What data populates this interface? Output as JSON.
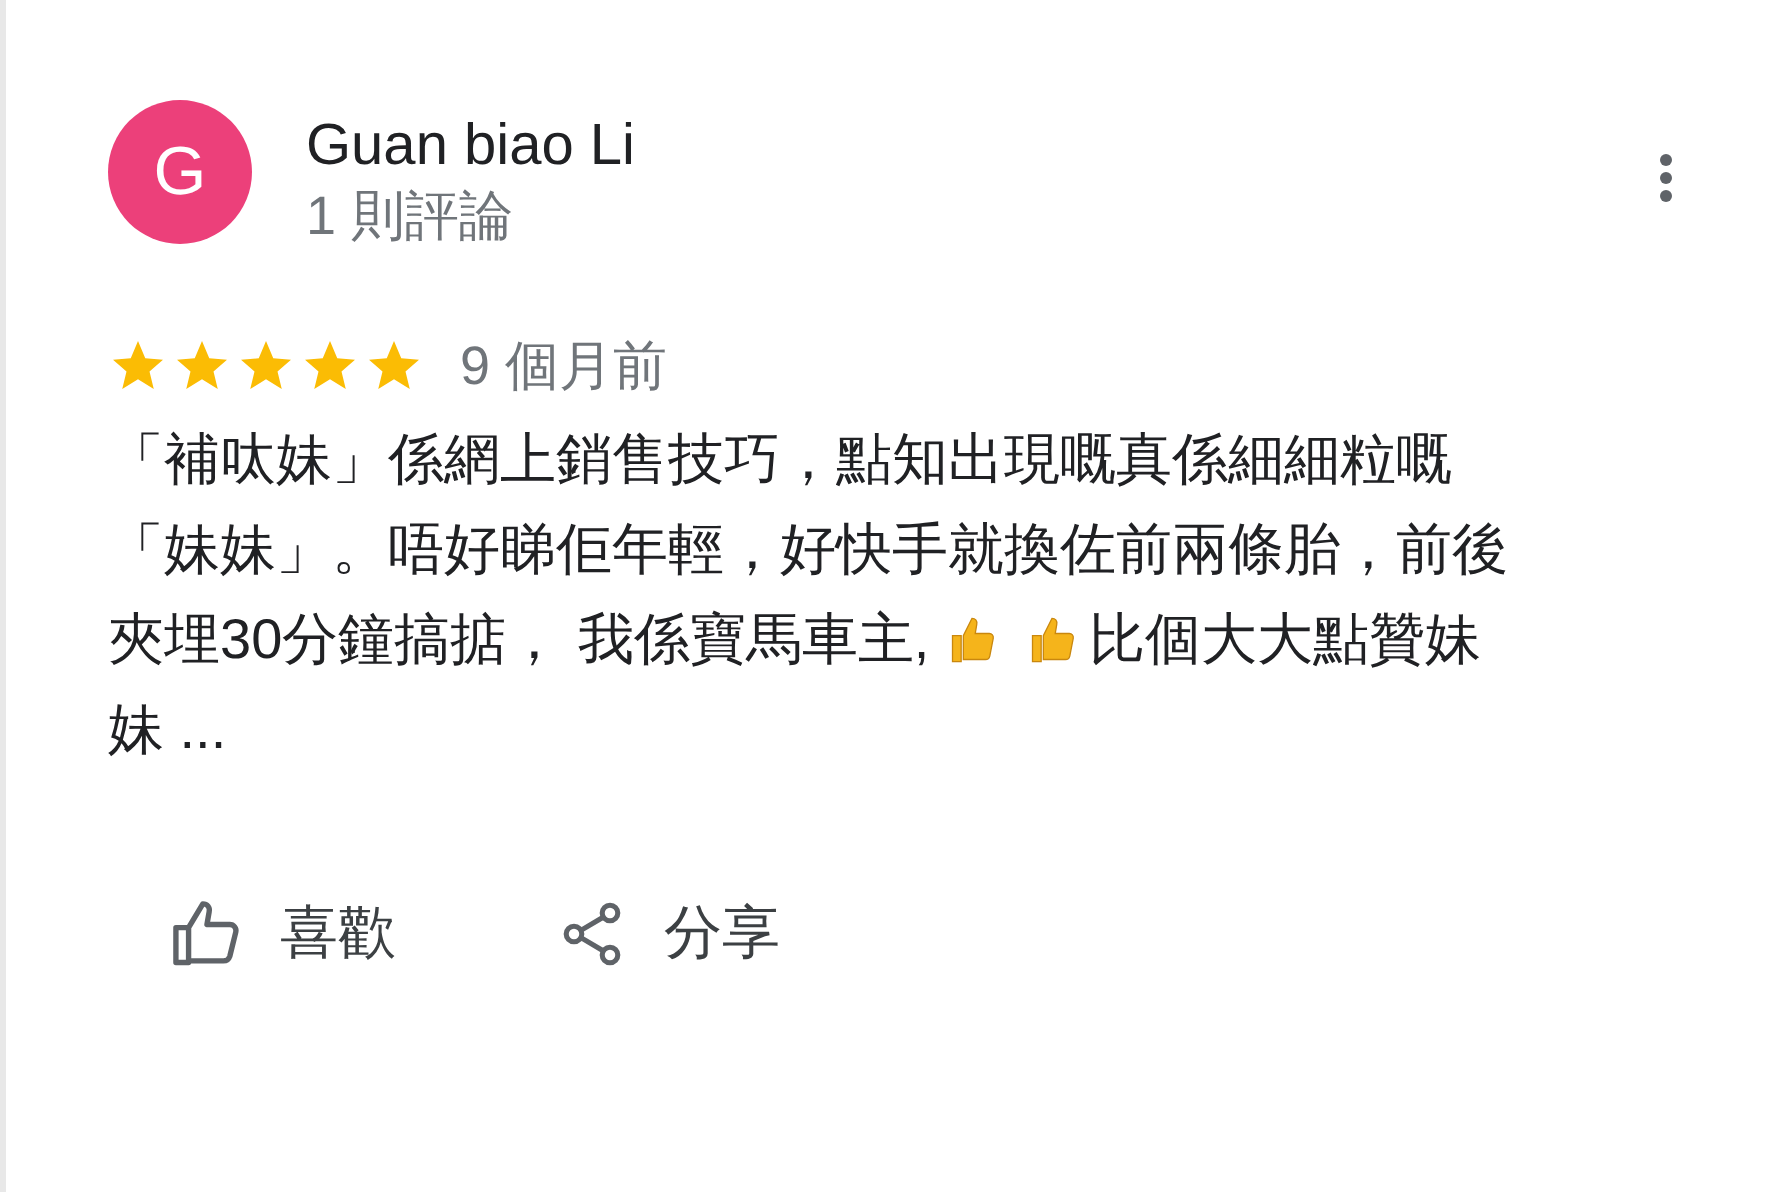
{
  "review": {
    "avatar_letter": "G",
    "author": "Guan biao Li",
    "review_count": "1 則評論",
    "stars": 5,
    "date": "9 個月前",
    "text_lines": [
      [
        {
          "kind": "text",
          "text": "「補呔妹」係網上銷售技巧，點知出現嘅真係細細粒嘅"
        }
      ],
      [
        {
          "kind": "text",
          "text": "「妹妹」。唔好睇佢年輕，好快手就換佐前兩條胎，前後"
        }
      ],
      [
        {
          "kind": "text",
          "text": "夾埋30分鐘搞掂， 我係寶馬車主,"
        },
        {
          "kind": "thumbs"
        },
        {
          "kind": "thumbs"
        },
        {
          "kind": "text",
          "text": "比個大大點贊妹"
        }
      ],
      [
        {
          "kind": "text",
          "text": "妹 ..."
        }
      ]
    ],
    "actions": [
      {
        "kind": "like",
        "label": "喜歡"
      },
      {
        "kind": "share",
        "label": "分享"
      }
    ]
  }
}
